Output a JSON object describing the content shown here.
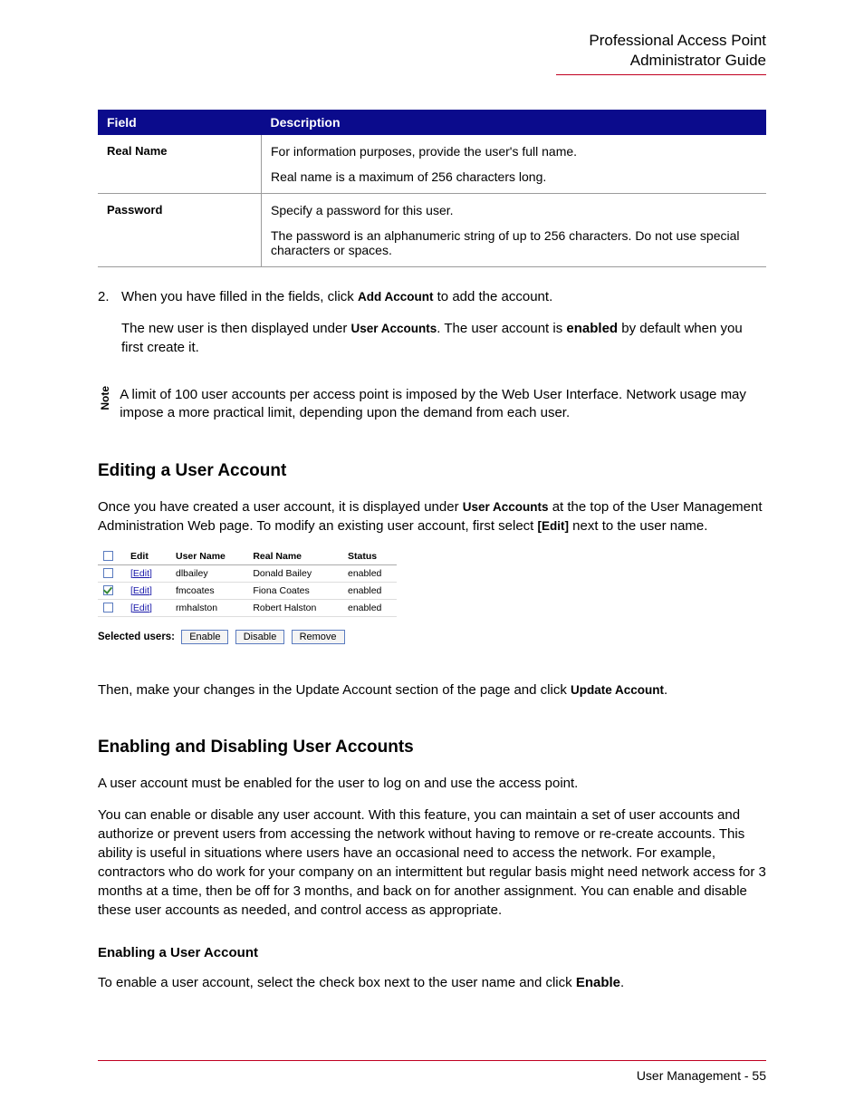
{
  "header": {
    "line1": "Professional Access Point",
    "line2": "Administrator Guide"
  },
  "fieldTable": {
    "headers": {
      "field": "Field",
      "description": "Description"
    },
    "rows": [
      {
        "field": "Real Name",
        "desc1": "For information purposes, provide the user's full name.",
        "desc2": "Real name is a maximum of 256 characters long."
      },
      {
        "field": "Password",
        "desc1": "Specify a password for this user.",
        "desc2": "The password is an alphanumeric string of up to 256 characters. Do not use special characters or spaces."
      }
    ]
  },
  "step2": {
    "num": "2.",
    "p1a": "When you have filled in the fields, click ",
    "p1b_label": "Add Account",
    "p1c": " to add the account.",
    "p2a": "The new user is then displayed under ",
    "p2b_label": "User Accounts",
    "p2c": ". The user account is ",
    "p2d_bold": "enabled",
    "p2e": " by default when you first create it."
  },
  "note": {
    "label": "Note",
    "text": "A limit of 100 user accounts per access point is imposed by the Web User Interface. Network usage may impose a more practical limit, depending upon the demand from each user."
  },
  "editing": {
    "heading": "Editing a User Account",
    "p1a": "Once you have created a user account, it is displayed under ",
    "p1b_label": "User Accounts",
    "p1c": " at the top of the User Management Administration Web page. To modify an existing user account, first select ",
    "p1d_label": "[Edit]",
    "p1e": " next to the user name.",
    "p2a": "Then, make your changes in the Update Account section of the page and click ",
    "p2b_label": "Update Account",
    "p2c": "."
  },
  "uiPanel": {
    "headers": {
      "edit": "Edit",
      "user": "User Name",
      "real": "Real Name",
      "status": "Status"
    },
    "editLink": "[Edit]",
    "rows": [
      {
        "checked": false,
        "user": "dlbailey",
        "real": "Donald Bailey",
        "status": "enabled"
      },
      {
        "checked": true,
        "user": "fmcoates",
        "real": "Fiona Coates",
        "status": "enabled"
      },
      {
        "checked": false,
        "user": "rmhalston",
        "real": "Robert Halston",
        "status": "enabled"
      }
    ],
    "selectedLabel": "Selected users:",
    "buttons": {
      "enable": "Enable",
      "disable": "Disable",
      "remove": "Remove"
    }
  },
  "enabling": {
    "heading": "Enabling and Disabling User Accounts",
    "p1": "A user account must be enabled for the user to log on and use the access point.",
    "p2": "You can enable or disable any user account. With this feature, you can maintain a set of user accounts and authorize or prevent users from accessing the network without having to remove or re-create accounts. This ability is useful in situations where users have an occasional need to access the network. For example, contractors who do work for your company on an intermittent but regular basis might need network access for 3 months at a time, then be off for 3 months, and back on for another assignment. You can enable and disable these user accounts as needed, and control access as appropriate.",
    "subheading": "Enabling a User Account",
    "p3a": "To enable a user account, select the check box next to the user name and click ",
    "p3b_bold": "Enable",
    "p3c": "."
  },
  "footer": {
    "text": "User Management - 55"
  }
}
